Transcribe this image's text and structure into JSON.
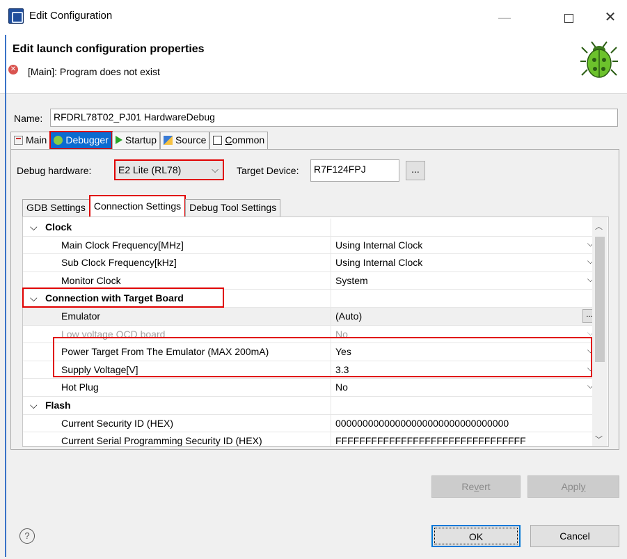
{
  "window": {
    "title": "Edit Configuration",
    "minimize_glyph": "—",
    "close_glyph": "✕"
  },
  "header": {
    "title": "Edit launch configuration properties",
    "error_message": "[Main]: Program does not exist"
  },
  "name_field": {
    "label": "Name:",
    "value": "RFDRL78T02_PJ01 HardwareDebug"
  },
  "main_tabs": [
    {
      "label_pre": "Main",
      "icon": "main-tab-icon"
    },
    {
      "label_pre": "Debugger",
      "icon": "debug-icon",
      "selected": true
    },
    {
      "label_pre": "Startup",
      "icon": "play-icon"
    },
    {
      "label_pre": "Source",
      "icon": "source-icon"
    },
    {
      "label_pre": "",
      "label_ul": "C",
      "label_post": "ommon",
      "icon": "common-icon"
    }
  ],
  "debugger": {
    "debug_hardware_label": "Debug hardware:",
    "debug_hardware_value": "E2 Lite (RL78)",
    "target_device_label": "Target Device:",
    "target_device_value": "R7F124FPJ",
    "browse_label": "..."
  },
  "sub_tabs": [
    {
      "label": "GDB Settings"
    },
    {
      "label": "Connection Settings",
      "selected": true
    },
    {
      "label": "Debug Tool Settings"
    }
  ],
  "properties": {
    "clock": {
      "category": "Clock",
      "rows": [
        {
          "name": "Main Clock Frequency[MHz]",
          "value": "Using Internal Clock"
        },
        {
          "name": "Sub Clock Frequency[kHz]",
          "value": "Using Internal Clock"
        },
        {
          "name": "Monitor Clock",
          "value": "System"
        }
      ]
    },
    "connection": {
      "category": "Connection with Target Board",
      "rows": [
        {
          "name": "Emulator",
          "value": "(Auto)"
        },
        {
          "name": "Low voltage OCD board",
          "value": "No"
        },
        {
          "name": "Power Target From The Emulator (MAX 200mA)",
          "value": "Yes"
        },
        {
          "name": "Supply Voltage[V]",
          "value": "3.3"
        },
        {
          "name": "Hot Plug",
          "value": "No"
        }
      ]
    },
    "flash": {
      "category": "Flash",
      "rows": [
        {
          "name": "Current Security ID (HEX)",
          "value": "00000000000000000000000000000000"
        },
        {
          "name": "Current Serial Programming Security ID (HEX)",
          "value": "FFFFFFFFFFFFFFFFFFFFFFFFFFFFFFFF"
        }
      ]
    }
  },
  "buttons": {
    "revert_pre": "Re",
    "revert_ul": "v",
    "revert_post": "ert",
    "apply_pre": "Appl",
    "apply_ul": "y",
    "ok": "OK",
    "cancel": "Cancel",
    "help": "?"
  },
  "colors": {
    "highlight_red": "#e00000",
    "selected_tab_blue": "#0b6bd1",
    "window_border_blue": "#3a73c8"
  }
}
